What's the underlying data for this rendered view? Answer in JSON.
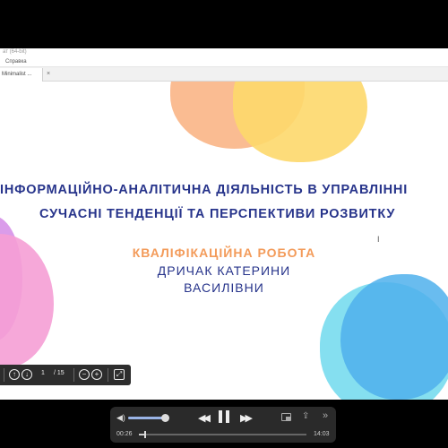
{
  "window": {
    "title_fragment": "ат (64-bit)",
    "menu_label": "Справка",
    "tab_label": "Minimalist ...",
    "tab_close": "×"
  },
  "slide": {
    "title_line1": "ІНФОРМАЦІЙНО-АНАЛІТИЧНА ДІЯЛЬНІСТЬ В УПРАВЛІННІ",
    "title_line2": "СУЧАСНІ ТЕНДЕНЦІЇ ТА ПЕРСПЕКТИВИ РОЗВИТКУ",
    "subtitle": "КВАЛІФІКАЦІЙНА РОБОТА",
    "author_line1": "ДРИЧАК КАТЕРИНИ",
    "author_line2": "ВАСИЛІВНИ",
    "colors": {
      "title": "#27348b",
      "subtitle": "#f39b5a"
    }
  },
  "pdf_toolbar": {
    "current_page": "1",
    "total_pages": "/ 15",
    "icons": [
      "page-up-icon",
      "page-down-icon",
      "zoom-out-icon",
      "zoom-in-icon",
      "fit-page-icon"
    ]
  },
  "video_player": {
    "current_time": "00:26",
    "total_time": "14:03",
    "progress": 0.031,
    "volume": 0.95,
    "icons": [
      "volume-icon",
      "rewind-icon",
      "pause-icon",
      "forward-icon",
      "picture-in-picture-icon",
      "share-icon",
      "more-icon"
    ]
  }
}
